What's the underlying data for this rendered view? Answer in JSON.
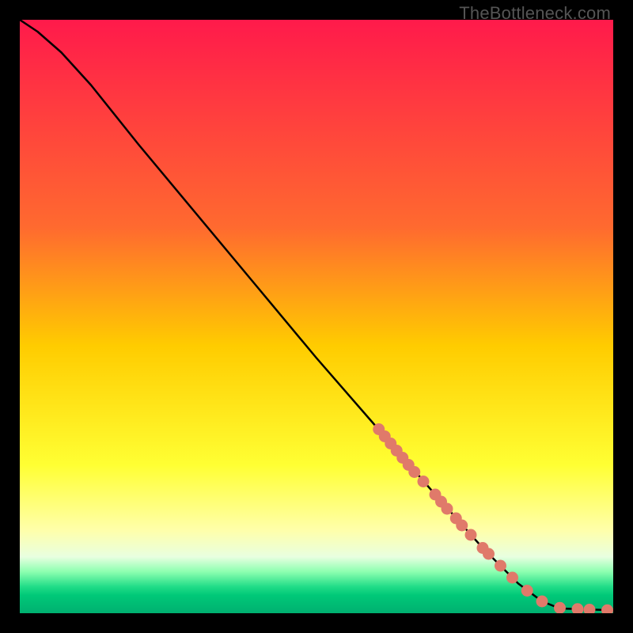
{
  "watermark": "TheBottleneck.com",
  "chart_data": {
    "type": "line",
    "xlim": [
      0,
      100
    ],
    "ylim": [
      0,
      100
    ],
    "title": "",
    "xlabel": "",
    "ylabel": "",
    "background_gradient": [
      {
        "pos": 0.0,
        "color": "#ff1a4b"
      },
      {
        "pos": 0.35,
        "color": "#ff6a2f"
      },
      {
        "pos": 0.55,
        "color": "#ffcc00"
      },
      {
        "pos": 0.75,
        "color": "#ffff33"
      },
      {
        "pos": 0.86,
        "color": "#ffffaa"
      },
      {
        "pos": 0.905,
        "color": "#e8ffe0"
      },
      {
        "pos": 0.93,
        "color": "#8dffb0"
      },
      {
        "pos": 0.955,
        "color": "#22dd88"
      },
      {
        "pos": 0.97,
        "color": "#00c878"
      },
      {
        "pos": 1.0,
        "color": "#00b070"
      }
    ],
    "curve": [
      {
        "x": 0,
        "y": 100
      },
      {
        "x": 3,
        "y": 98
      },
      {
        "x": 7,
        "y": 94.5
      },
      {
        "x": 12,
        "y": 89
      },
      {
        "x": 20,
        "y": 79
      },
      {
        "x": 30,
        "y": 67
      },
      {
        "x": 40,
        "y": 55
      },
      {
        "x": 50,
        "y": 43
      },
      {
        "x": 60,
        "y": 31.5
      },
      {
        "x": 70,
        "y": 20
      },
      {
        "x": 78,
        "y": 11
      },
      {
        "x": 84,
        "y": 5
      },
      {
        "x": 88,
        "y": 2
      },
      {
        "x": 91,
        "y": 0.8
      },
      {
        "x": 100,
        "y": 0.5
      }
    ],
    "markers": [
      {
        "x": 60.5,
        "y": 31.0
      },
      {
        "x": 61.5,
        "y": 29.8
      },
      {
        "x": 62.5,
        "y": 28.6
      },
      {
        "x": 63.5,
        "y": 27.4
      },
      {
        "x": 64.5,
        "y": 26.2
      },
      {
        "x": 65.5,
        "y": 25.0
      },
      {
        "x": 66.5,
        "y": 23.8
      },
      {
        "x": 68.0,
        "y": 22.2
      },
      {
        "x": 70.0,
        "y": 20.0
      },
      {
        "x": 71.0,
        "y": 18.8
      },
      {
        "x": 72.0,
        "y": 17.6
      },
      {
        "x": 73.5,
        "y": 16.0
      },
      {
        "x": 74.5,
        "y": 14.8
      },
      {
        "x": 76.0,
        "y": 13.2
      },
      {
        "x": 78.0,
        "y": 11.0
      },
      {
        "x": 79.0,
        "y": 10.0
      },
      {
        "x": 81.0,
        "y": 8.0
      },
      {
        "x": 83.0,
        "y": 6.0
      },
      {
        "x": 85.5,
        "y": 3.8
      },
      {
        "x": 88.0,
        "y": 2.0
      },
      {
        "x": 91.0,
        "y": 0.9
      },
      {
        "x": 94.0,
        "y": 0.7
      },
      {
        "x": 96.0,
        "y": 0.6
      },
      {
        "x": 99.0,
        "y": 0.5
      }
    ],
    "marker_color": "#e07a6a",
    "curve_color": "#000000"
  }
}
